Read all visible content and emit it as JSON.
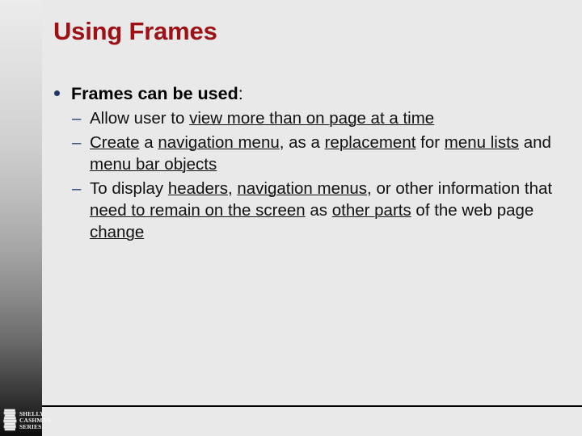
{
  "slide": {
    "title": "Using Frames",
    "title_color": "#9c1016",
    "background_color": "#e9e9e9",
    "bullet_color": "#1f3864",
    "dash_color": "#21436f"
  },
  "content": {
    "level1": {
      "bold_text": "Frames can be used",
      "trailing_text": ":"
    },
    "sub_bullets": [
      {
        "dash": "–",
        "segments": [
          {
            "text": "Allow user to ",
            "underline": false
          },
          {
            "text": "view more than on page at a time",
            "underline": true
          }
        ],
        "plain": "Allow user to view more than on page at a time"
      },
      {
        "dash": "–",
        "segments": [
          {
            "text": "Create",
            "underline": true
          },
          {
            "text": " a ",
            "underline": false
          },
          {
            "text": "navigation menu",
            "underline": true
          },
          {
            "text": ", as a ",
            "underline": false
          },
          {
            "text": "replacement",
            "underline": true
          },
          {
            "text": " for ",
            "underline": false
          },
          {
            "text": "menu lists",
            "underline": true
          },
          {
            "text": " and ",
            "underline": false
          },
          {
            "text": "menu bar objects",
            "underline": true
          }
        ],
        "plain": "Create a navigation menu, as a replacement for menu lists and menu bar objects"
      },
      {
        "dash": "–",
        "segments": [
          {
            "text": "To display ",
            "underline": false
          },
          {
            "text": "headers",
            "underline": true
          },
          {
            "text": ", ",
            "underline": false
          },
          {
            "text": "navigation menus",
            "underline": true
          },
          {
            "text": ", or other information that ",
            "underline": false
          },
          {
            "text": "need to remain on the screen",
            "underline": true
          },
          {
            "text": " as ",
            "underline": false
          },
          {
            "text": "other parts",
            "underline": true
          },
          {
            "text": " of the web page ",
            "underline": false
          },
          {
            "text": "change",
            "underline": true
          }
        ],
        "plain": "To display headers, navigation menus, or other information that need to remain on the screen as other parts of the web page change"
      }
    ]
  },
  "footer": {
    "logo": {
      "icon": "stacked-books-icon",
      "line1": "Shelly",
      "line2": "Cashman",
      "line3": "Series."
    }
  }
}
